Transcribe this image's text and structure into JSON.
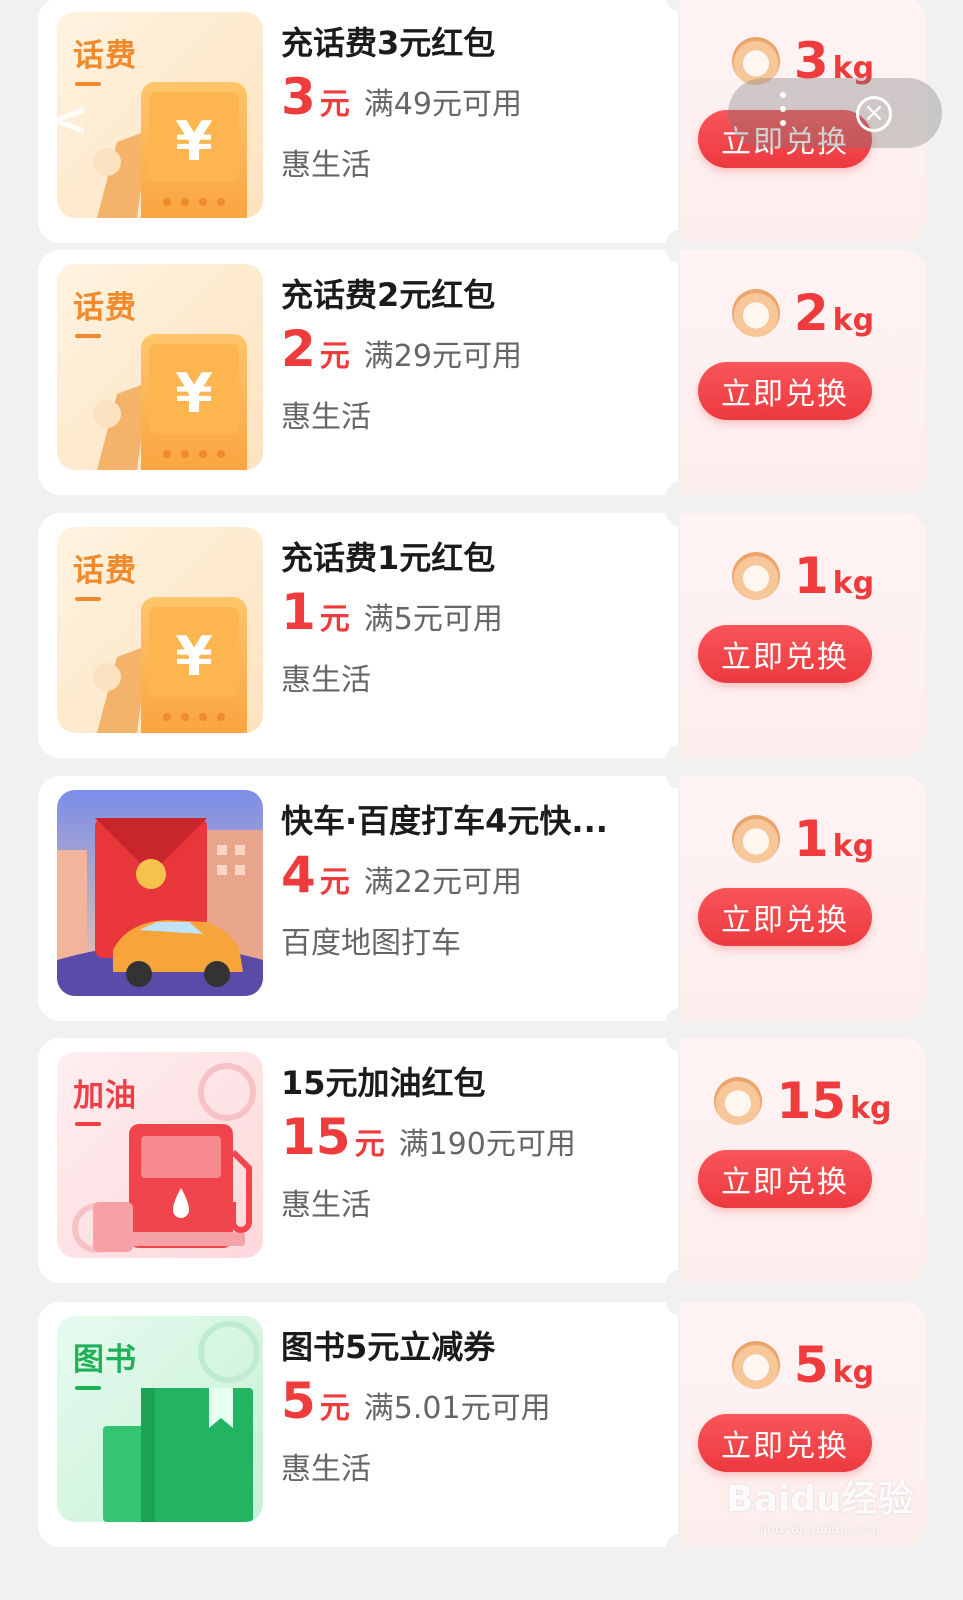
{
  "top_controls": {
    "back_icon": "chevron-left-icon",
    "more_icon": "more-dots-icon",
    "close_icon": "close-circle-icon",
    "close_glyph": "×",
    "back_glyph": "<"
  },
  "colors": {
    "price_red": "#ef3b3b",
    "button_red": "#ec3a3f",
    "card_bg": "#ffffff",
    "page_bg": "#f1f1f1"
  },
  "items": [
    {
      "thumb_type": "phone-bill",
      "thumb_label": "话费",
      "title": "充话费3元红包",
      "price": "3",
      "price_unit": "元",
      "condition": "满49元可用",
      "merchant": "惠生活",
      "cost_num": "3",
      "cost_unit": "kg",
      "button": "立即兑换"
    },
    {
      "thumb_type": "phone-bill",
      "thumb_label": "话费",
      "title": "充话费2元红包",
      "price": "2",
      "price_unit": "元",
      "condition": "满29元可用",
      "merchant": "惠生活",
      "cost_num": "2",
      "cost_unit": "kg",
      "button": "立即兑换"
    },
    {
      "thumb_type": "phone-bill",
      "thumb_label": "话费",
      "title": "充话费1元红包",
      "price": "1",
      "price_unit": "元",
      "condition": "满5元可用",
      "merchant": "惠生活",
      "cost_num": "1",
      "cost_unit": "kg",
      "button": "立即兑换"
    },
    {
      "thumb_type": "taxi",
      "thumb_label": "",
      "title": "快车·百度打车4元快...",
      "price": "4",
      "price_unit": "元",
      "condition": "满22元可用",
      "merchant": "百度地图打车",
      "cost_num": "1",
      "cost_unit": "kg",
      "button": "立即兑换"
    },
    {
      "thumb_type": "fuel",
      "thumb_label": "加油",
      "title": "15元加油红包",
      "price": "15",
      "price_unit": "元",
      "condition": "满190元可用",
      "merchant": "惠生活",
      "cost_num": "15",
      "cost_unit": "kg",
      "button": "立即兑换"
    },
    {
      "thumb_type": "books",
      "thumb_label": "图书",
      "title": "图书5元立减券",
      "price": "5",
      "price_unit": "元",
      "condition": "满5.01元可用",
      "merchant": "惠生活",
      "cost_num": "5",
      "cost_unit": "kg",
      "button": "立即兑换"
    }
  ],
  "watermark": {
    "logo": "Baidu经验",
    "url": "jingyan.baidu.com"
  }
}
